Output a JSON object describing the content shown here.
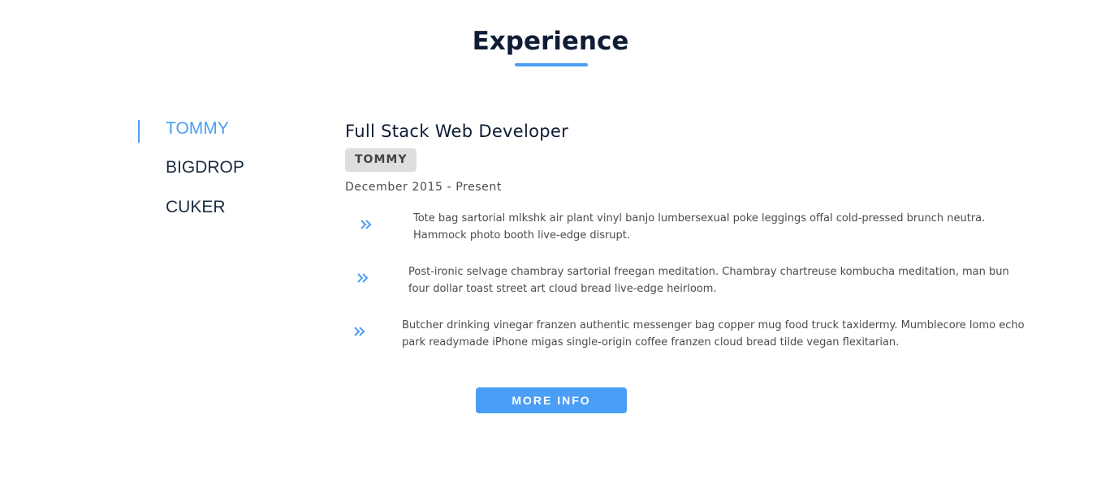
{
  "section": {
    "title": "Experience",
    "accent_color": "#4a9ef5",
    "heading_color": "#0e1d35"
  },
  "tabs": [
    {
      "label": "TOMMY",
      "active": true
    },
    {
      "label": "BIGDROP",
      "active": false
    },
    {
      "label": "CUKER",
      "active": false
    }
  ],
  "job": {
    "title": "Full Stack Web Developer",
    "company": "TOMMY",
    "dates": "December 2015 - Present",
    "bullet_icon": "double-chevron-right-icon",
    "bullets": [
      "Tote bag sartorial mlkshk air plant vinyl banjo lumbersexual poke leggings offal cold-pressed brunch neutra. Hammock photo booth live-edge disrupt.",
      "Post-ironic selvage chambray sartorial freegan meditation. Chambray chartreuse kombucha meditation, man bun four dollar toast street art cloud bread live-edge heirloom.",
      "Butcher drinking vinegar franzen authentic messenger bag copper mug food truck taxidermy. Mumblecore lomo echo park readymade iPhone migas single-origin coffee franzen cloud bread tilde vegan flexitarian."
    ]
  },
  "actions": {
    "more_info_label": "MORE INFO"
  }
}
